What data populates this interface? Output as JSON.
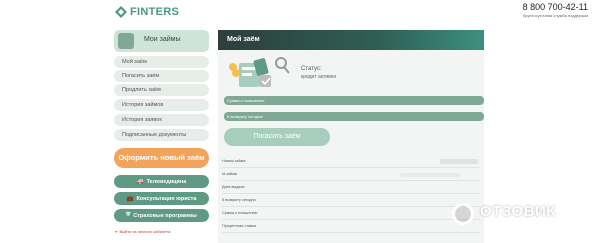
{
  "header": {
    "logo_text": "FINTERS",
    "phone": "8 800 700-42-11",
    "phone_sub": "Круглосуточная служба поддержки"
  },
  "sidebar": {
    "title": "Мои займы",
    "items": [
      {
        "label": "Мой заём"
      },
      {
        "label": "Погасить заём"
      },
      {
        "label": "Продлить заём"
      },
      {
        "label": "История займов"
      },
      {
        "label": "История заявок"
      },
      {
        "label": "Подписанные документы"
      }
    ],
    "cta_label": "Оформить новый заём",
    "buttons": [
      {
        "label": "Телемедицина",
        "icon": "car-icon"
      },
      {
        "label": "Консультация юриста",
        "icon": "briefcase-icon"
      },
      {
        "label": "Страховые программы",
        "icon": "shield-icon"
      }
    ],
    "logout": "Выйти из личного кабинета"
  },
  "main": {
    "title": "Мой заём",
    "status_label": "Статус:",
    "status_value": "кредит активен",
    "bars": [
      {
        "label": "Сумма к погашению"
      },
      {
        "label": "К возврату сегодня"
      }
    ],
    "pay_button": "Погасить заём",
    "rows": [
      {
        "label": "Номер займа"
      },
      {
        "label": "Id займа"
      },
      {
        "label": "Дата выдачи"
      },
      {
        "label": "К возврату сегодня"
      },
      {
        "label": "Сумма к погашению"
      },
      {
        "label": "Процентная ставка"
      }
    ]
  },
  "watermark": {
    "text": "ОТЗОВИК"
  },
  "colors": {
    "accent": "#5e9a84",
    "cta": "#f2a35c",
    "header_dark": "#2d3e3b"
  }
}
